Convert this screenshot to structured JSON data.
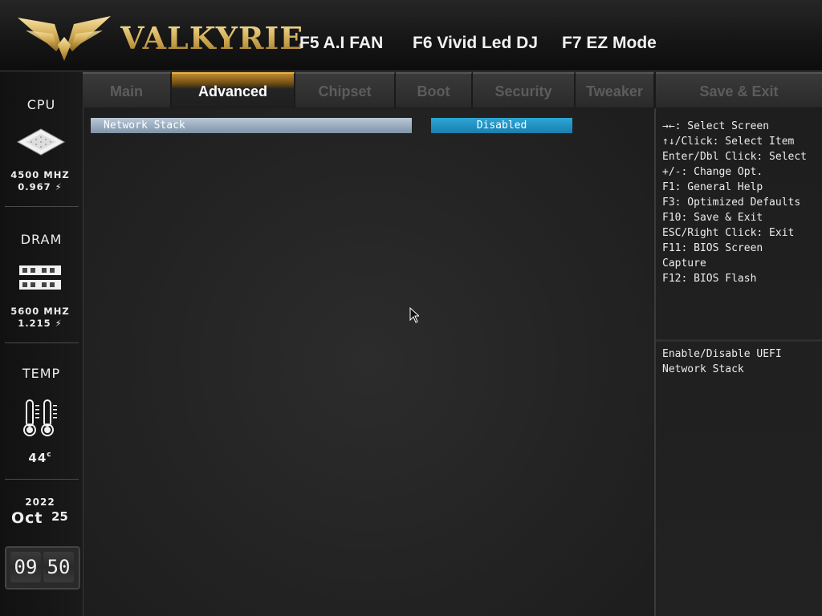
{
  "header": {
    "brand": "VALKYRIE",
    "hotkeys": {
      "ai_fan": "F5 A.I FAN",
      "vivid_led": "F6 Vivid Led DJ",
      "ez_mode": "F7 EZ Mode"
    }
  },
  "sidebar": {
    "cpu": {
      "title": "CPU",
      "freq": "4500 MHZ",
      "volt": "0.967"
    },
    "dram": {
      "title": "DRAM",
      "freq": "5600 MHZ",
      "volt": "1.215"
    },
    "temp": {
      "title": "TEMP",
      "value": "44"
    },
    "date": {
      "year": "2022",
      "month": "Oct",
      "day": "25"
    },
    "time": {
      "hour": "09",
      "minute": "50"
    }
  },
  "tabs": [
    {
      "label": "Main",
      "active": false
    },
    {
      "label": "Advanced",
      "active": true
    },
    {
      "label": "Chipset",
      "active": false
    },
    {
      "label": "Boot",
      "active": false
    },
    {
      "label": "Security",
      "active": false
    },
    {
      "label": "Tweaker",
      "active": false
    },
    {
      "label": "Save & Exit",
      "active": false
    }
  ],
  "main": {
    "settings": [
      {
        "label": "Network Stack",
        "value": "Disabled"
      }
    ]
  },
  "help": {
    "keys": [
      "→←: Select Screen",
      "↑↓/Click: Select Item",
      "Enter/Dbl Click: Select",
      "+/-: Change Opt.",
      "F1: General Help",
      "F3: Optimized Defaults",
      "F10: Save & Exit",
      "ESC/Right Click: Exit",
      "F11: BIOS Screen",
      "Capture",
      "F12: BIOS Flash"
    ],
    "description_lines": [
      "Enable/Disable UEFI",
      "Network Stack"
    ]
  },
  "colors": {
    "accent_gold": "#d7b25a",
    "selected_value": "#1f8fc0",
    "row_highlight": "#a3b5c8"
  }
}
